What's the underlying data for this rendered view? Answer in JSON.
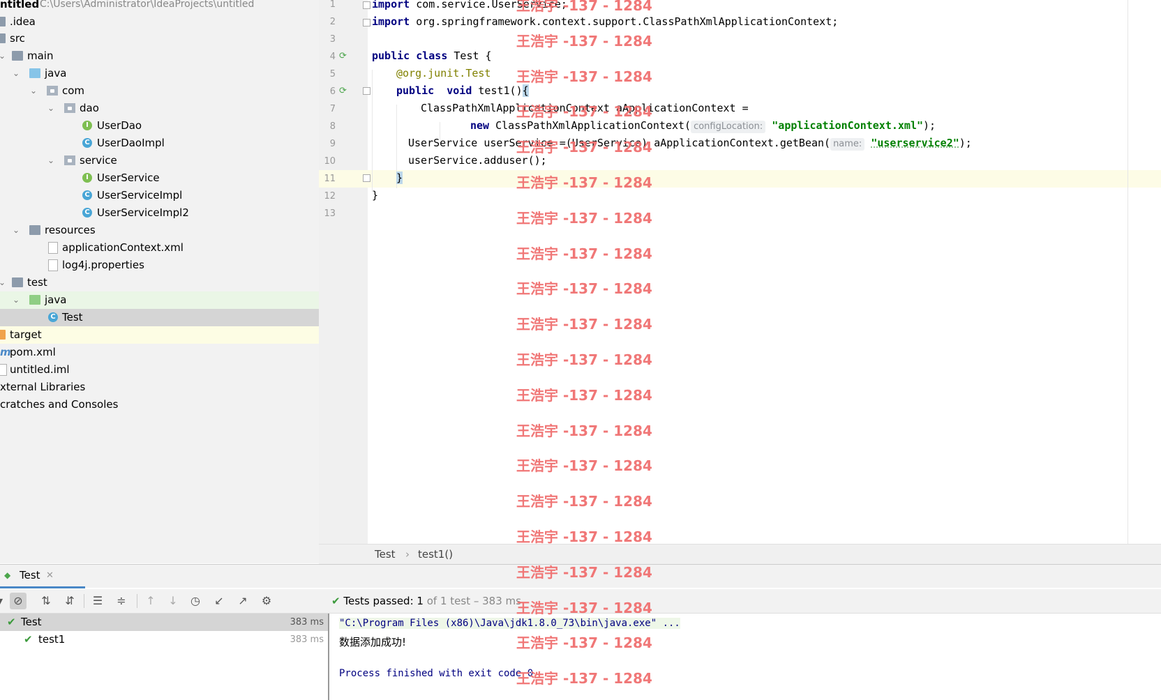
{
  "project": {
    "root_name": "ntitled",
    "root_path": "C:\\Users\\Administrator\\IdeaProjects\\untitled",
    "items": [
      {
        "label": ".idea"
      },
      {
        "label": "src"
      },
      {
        "label": "main"
      },
      {
        "label": "java"
      },
      {
        "label": "com"
      },
      {
        "label": "dao"
      },
      {
        "label": "UserDao"
      },
      {
        "label": "UserDaoImpl"
      },
      {
        "label": "service"
      },
      {
        "label": "UserService"
      },
      {
        "label": "UserServiceImpl"
      },
      {
        "label": "UserServiceImpl2"
      },
      {
        "label": "resources"
      },
      {
        "label": "applicationContext.xml"
      },
      {
        "label": "log4j.properties"
      },
      {
        "label": "test"
      },
      {
        "label": "java"
      },
      {
        "label": "Test"
      },
      {
        "label": "target"
      },
      {
        "label": "pom.xml"
      },
      {
        "label": "untitled.iml"
      },
      {
        "label": "xternal Libraries"
      },
      {
        "label": "cratches and Consoles"
      }
    ]
  },
  "editor": {
    "line_numbers": [
      "1",
      "2",
      "3",
      "4",
      "5",
      "6",
      "7",
      "8",
      "9",
      "10",
      "11",
      "12",
      "13"
    ],
    "l1_kw": "import",
    "l1_rest": " com.service.UserService;",
    "l2_kw": "import",
    "l2_rest": " org.springframework.context.support.ClassPathXmlApplicationContext;",
    "l4_kw1": "public",
    "l4_kw2": "class",
    "l4_rest": " Test {",
    "l5_at": "@org.junit.",
    "l5_ann": "Test",
    "l6_kw1": "public",
    "l6_kw2": "void",
    "l6_rest": " test1()",
    "l6_brace": "{",
    "l7": "ClassPathXmlApplicationContext aApplicationContext =",
    "l8_kw": "new",
    "l8_rest": " ClassPathXmlApplicationContext(",
    "l8_hint": "configLocation:",
    "l8_str": "\"applicationContext.xml\"",
    "l8_end": ");",
    "l9": "UserService userService =(UserService) aApplicationContext.getBean(",
    "l9_hint": "name:",
    "l9_str": "\"userservice2\"",
    "l9_end": ");",
    "l10": "userService.adduser();",
    "l11": "}",
    "l12": "}"
  },
  "breadcrumb": {
    "class": "Test",
    "sep": "›",
    "method": "test1()"
  },
  "run": {
    "tab_label": "Test",
    "tests_passed_label": "Tests passed:",
    "tests_passed_count": "1",
    "tests_of": "of 1 test – 383 ms",
    "tree": [
      {
        "label": "Test",
        "ms": "383 ms"
      },
      {
        "label": "test1",
        "ms": "383 ms"
      }
    ],
    "console": [
      "\"C:\\Program Files (x86)\\Java\\jdk1.8.0_73\\bin\\java.exe\" ...",
      "数据添加成功!",
      "Process finished with exit code 0"
    ]
  },
  "watermark": "王浩宇 -137 - 1284",
  "colors": {
    "keyword": "#000080",
    "string": "#008000",
    "annotation": "#808000",
    "watermark": "#f07070",
    "pass": "#3c9a3c"
  }
}
